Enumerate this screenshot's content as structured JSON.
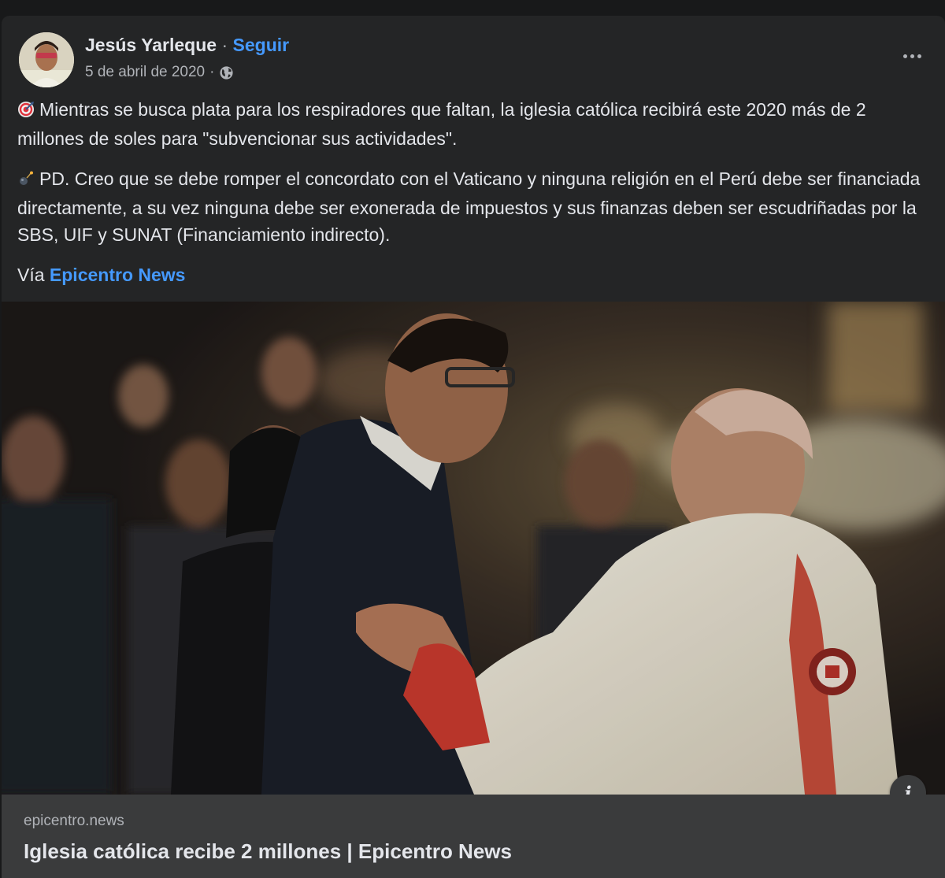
{
  "post": {
    "author": "Jesús Yarleque",
    "separator": "·",
    "follow_label": "Seguir",
    "date": "5 de abril de 2020",
    "date_separator": "·",
    "privacy_icon": "globe-icon",
    "more_icon": "more-options-icon",
    "paragraphs": [
      {
        "emoji": "target-emoji",
        "text": "Mientras se busca plata para los respiradores que faltan, la iglesia católica recibirá este 2020 más de 2 millones de soles para \"subvencionar sus actividades\"."
      },
      {
        "emoji": "sparkle-emoji",
        "text": "PD. Creo que se debe romper el concordato con el Vaticano y ninguna religión en el Perú debe ser financiada directamente, a su vez ninguna debe ser exonerada de impuestos y sus finanzas deben ser escudriñadas por la SBS, UIF y SUNAT (Financiamiento indirecto)."
      }
    ],
    "via_prefix": "Vía",
    "via_link": "Epicentro News"
  },
  "link_card": {
    "info_label": "i",
    "domain": "epicentro.news",
    "title": "Iglesia católica recibe 2 millones | Epicentro News"
  },
  "colors": {
    "background": "#18191a",
    "card": "#242526",
    "link": "#4599ff",
    "text_primary": "#e4e6eb",
    "text_secondary": "#b0b3b8",
    "footer": "#3a3b3c"
  }
}
